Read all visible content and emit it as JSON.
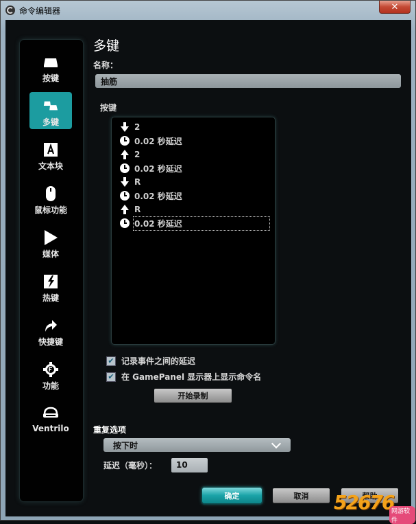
{
  "window": {
    "title": "命令编辑器",
    "close_glyph": "✕"
  },
  "sidebar": {
    "items": [
      {
        "label": "按键",
        "icon": "keycap-icon",
        "active": false
      },
      {
        "label": "多键",
        "icon": "multikey-icon",
        "active": true
      },
      {
        "label": "文本块",
        "icon": "text-block-icon",
        "active": false
      },
      {
        "label": "鼠标功能",
        "icon": "mouse-icon",
        "active": false
      },
      {
        "label": "媒体",
        "icon": "play-icon",
        "active": false
      },
      {
        "label": "热键",
        "icon": "hotkey-icon",
        "active": false
      },
      {
        "label": "快捷键",
        "icon": "shortcut-arrow-icon",
        "active": false
      },
      {
        "label": "功能",
        "icon": "function-gear-icon",
        "active": false
      },
      {
        "label": "Ventrilo",
        "icon": "headset-icon",
        "active": false
      }
    ]
  },
  "main": {
    "heading": "多键",
    "name_label": "名称：",
    "name_value": "抽筋",
    "keys_label": "按键",
    "events": [
      {
        "type": "down",
        "icon": "arrow-down-icon",
        "text": "2"
      },
      {
        "type": "delay",
        "icon": "clock-icon",
        "text": "0.02 秒延迟"
      },
      {
        "type": "up",
        "icon": "arrow-up-icon",
        "text": "2"
      },
      {
        "type": "delay",
        "icon": "clock-icon",
        "text": "0.02 秒延迟"
      },
      {
        "type": "down",
        "icon": "arrow-down-icon",
        "text": "R"
      },
      {
        "type": "delay",
        "icon": "clock-icon",
        "text": "0.02 秒延迟"
      },
      {
        "type": "up",
        "icon": "arrow-up-icon",
        "text": "R"
      },
      {
        "type": "delay",
        "icon": "clock-icon",
        "text": "0.02 秒延迟",
        "selected": true
      }
    ],
    "record_delay_label": "记录事件之间的延迟",
    "record_delay_checked": true,
    "gamepanel_label": "在 GamePanel 显示器上显示命令名",
    "gamepanel_checked": true,
    "start_record_label": "开始录制",
    "repeat_label": "重复选项",
    "repeat_value": "按下时",
    "delay_label": "延迟（毫秒）：",
    "delay_value": "10"
  },
  "footer": {
    "ok_label": "确定",
    "cancel_label": "取消",
    "help_label": "帮助"
  },
  "watermark": {
    "text": "52676",
    "badge": "网游软件"
  },
  "colors": {
    "accent": "#1c9ca0",
    "background": "#0c0f11"
  }
}
